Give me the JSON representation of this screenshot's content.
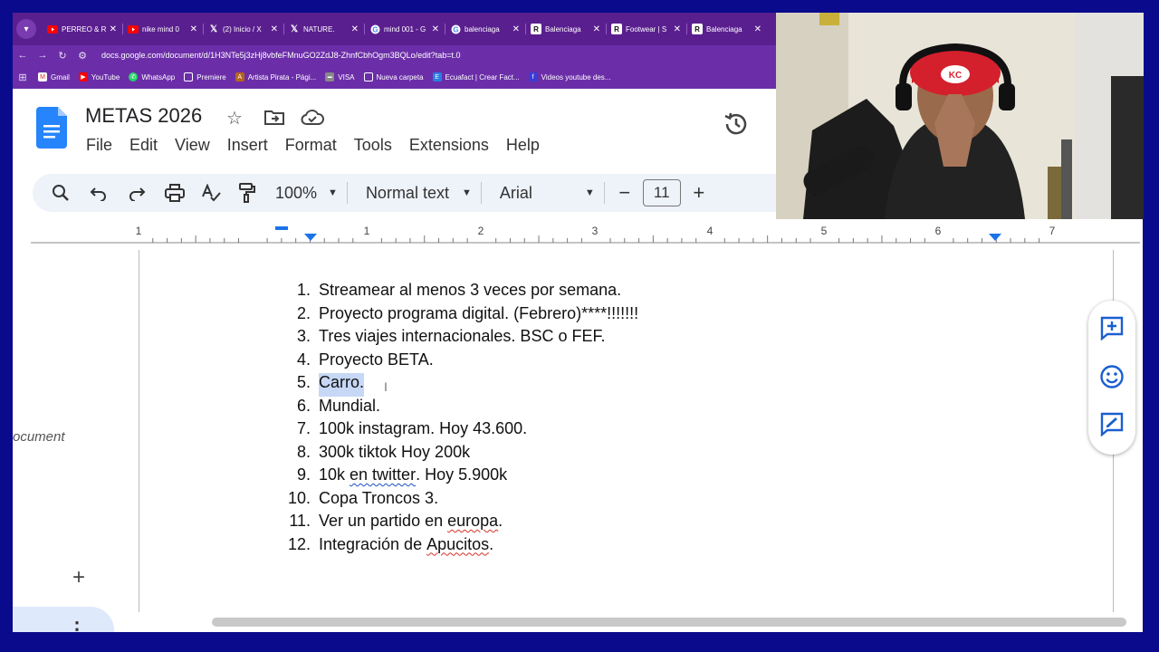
{
  "browser": {
    "tabs": [
      {
        "title": "PERREO & R",
        "icon": "youtube-icon"
      },
      {
        "title": "nike mind 0",
        "icon": "youtube-icon"
      },
      {
        "title": "(2) Inicio / X",
        "icon": "x-icon"
      },
      {
        "title": "NATURE.",
        "icon": "x-icon"
      },
      {
        "title": "mind 001 - G",
        "icon": "google-icon"
      },
      {
        "title": "balenciaga",
        "icon": "google-icon"
      },
      {
        "title": "Balenciaga",
        "icon": "r-icon"
      },
      {
        "title": "Footwear | S",
        "icon": "r-icon"
      },
      {
        "title": "Balenciaga",
        "icon": "r-icon"
      }
    ],
    "url": "docs.google.com/document/d/1H3NTe5j3zHj8vbfeFMnuGO2ZdJ8-ZhnfCbhOgm3BQLo/edit?tab=t.0",
    "bookmarks": [
      {
        "label": "Gmail",
        "icon": "gmail-icon"
      },
      {
        "label": "YouTube",
        "icon": "youtube-icon"
      },
      {
        "label": "WhatsApp",
        "icon": "whatsapp-icon"
      },
      {
        "label": "Premiere",
        "icon": "folder-icon"
      },
      {
        "label": "Artista Pirata - Pági...",
        "icon": "ap-icon"
      },
      {
        "label": "VISA",
        "icon": "visa-icon"
      },
      {
        "label": "Nueva carpeta",
        "icon": "folder-icon"
      },
      {
        "label": "Ecuafact | Crear Fact...",
        "icon": "ecuafact-icon"
      },
      {
        "label": "Videos youtube des...",
        "icon": "video-icon"
      }
    ]
  },
  "doc": {
    "title": "METAS 2026",
    "menu": [
      "File",
      "Edit",
      "View",
      "Insert",
      "Format",
      "Tools",
      "Extensions",
      "Help"
    ],
    "toolbar": {
      "zoom": "100%",
      "style": "Normal text",
      "font": "Arial",
      "font_size": "11"
    },
    "ruler_numbers": [
      "1",
      "1",
      "2",
      "3",
      "4",
      "5",
      "6",
      "7"
    ],
    "side_panel": {
      "document_label": "ocument"
    },
    "list": [
      {
        "n": "1.",
        "text": "Streamear al menos 3 veces por semana."
      },
      {
        "n": "2.",
        "text": "Proyecto programa digital. (Febrero)****!!!!!!!"
      },
      {
        "n": "3.",
        "text": "Tres viajes internacionales. BSC o FEF."
      },
      {
        "n": "4.",
        "text": "Proyecto BETA."
      },
      {
        "n": "5.",
        "text": "Carro."
      },
      {
        "n": "6.",
        "text": "Mundial."
      },
      {
        "n": "7.",
        "text": "100k instagram. Hoy 43.600."
      },
      {
        "n": "8.",
        "text": "300k tiktok Hoy 200k"
      },
      {
        "n": "9.",
        "text_pre": "10k ",
        "text_spell": "en twitter",
        "text_post": ". Hoy 5.900k"
      },
      {
        "n": "10.",
        "text": "Copa Troncos 3."
      },
      {
        "n": "11.",
        "text_pre": "Ver un partido en ",
        "text_spell": "europa",
        "text_post": "."
      },
      {
        "n": "12.",
        "text_pre": "Integración de ",
        "text_spell": "Apucitos",
        "text_post": "."
      }
    ]
  }
}
